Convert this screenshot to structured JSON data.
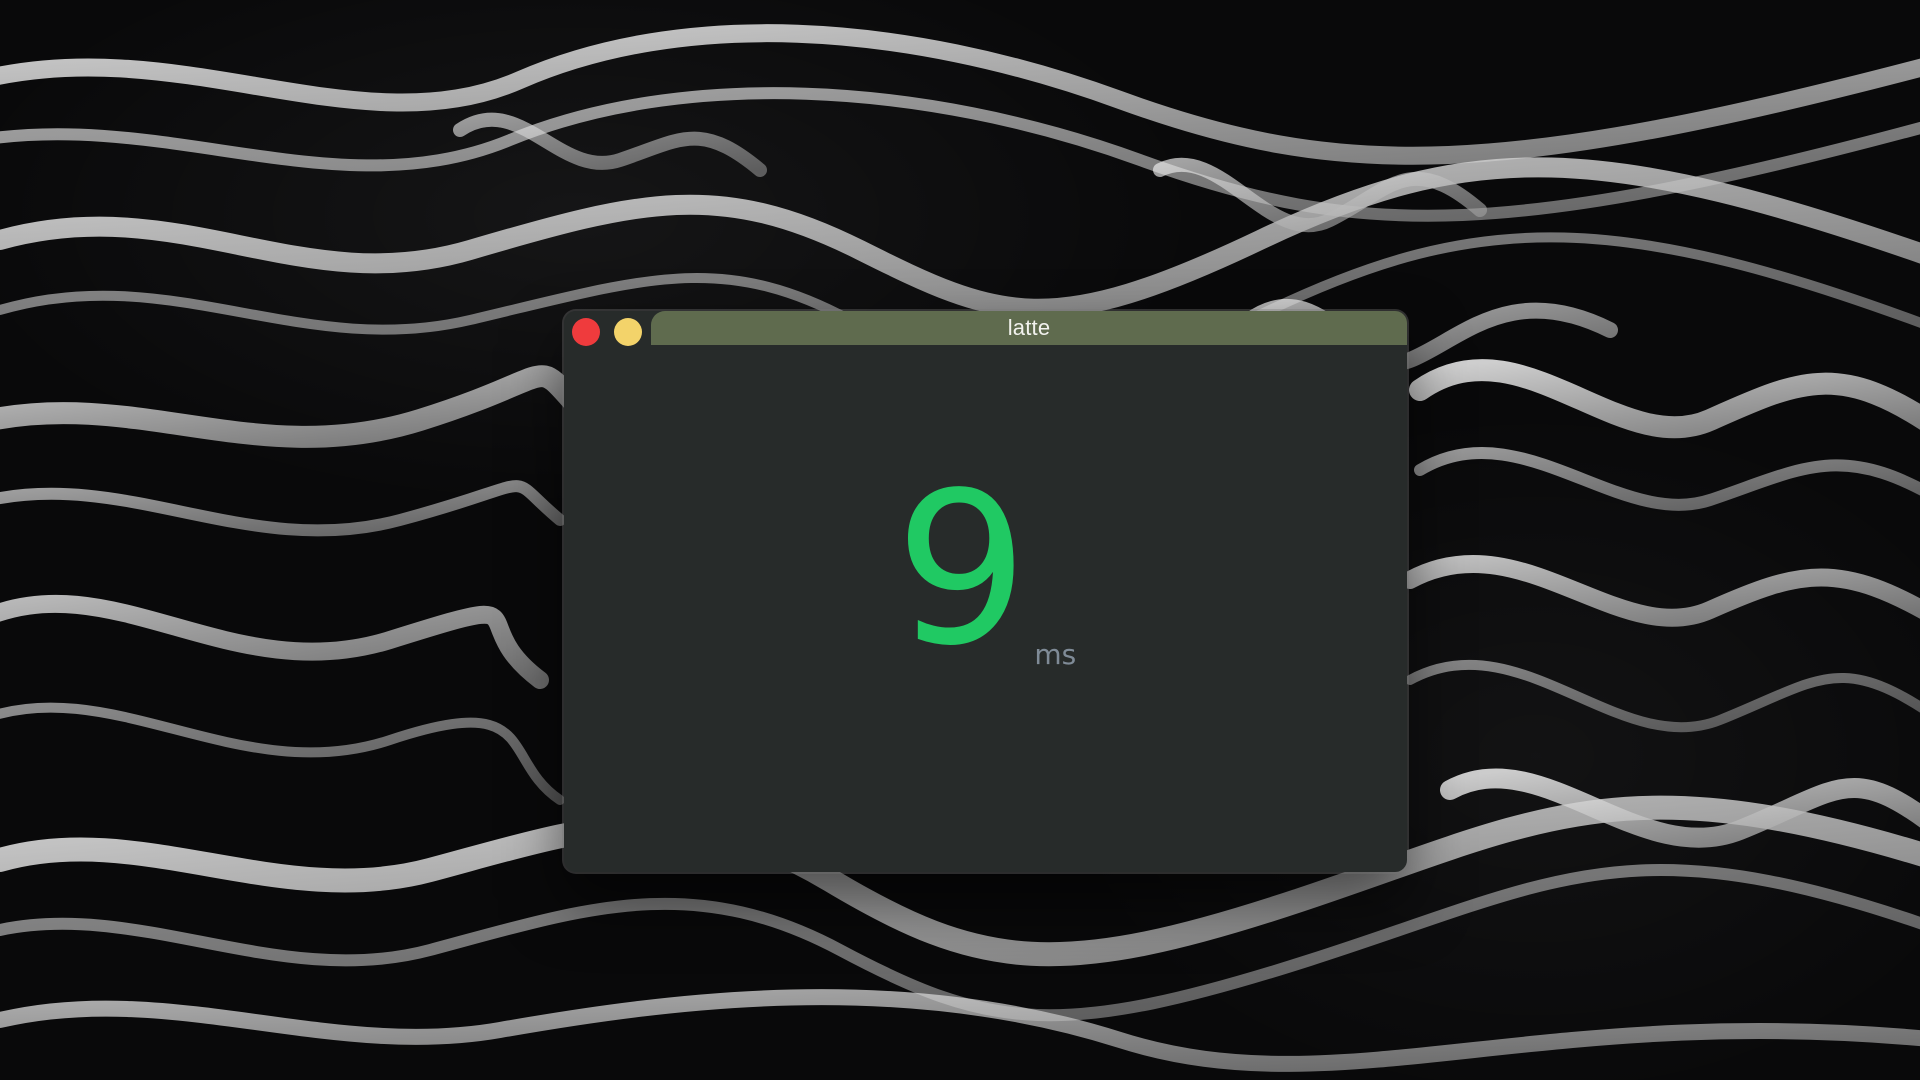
{
  "window": {
    "title": "latte"
  },
  "metric": {
    "value": "9",
    "unit": "ms"
  },
  "colors": {
    "close": "#ef3b3d",
    "minimize": "#f3d36a",
    "title_bar_fill": "#5f6b4e",
    "window_background": "#272b2a",
    "value": "#20c963",
    "unit": "#7f8b97"
  },
  "icons": {
    "close_button": "close-icon",
    "minimize_button": "minimize-icon"
  }
}
